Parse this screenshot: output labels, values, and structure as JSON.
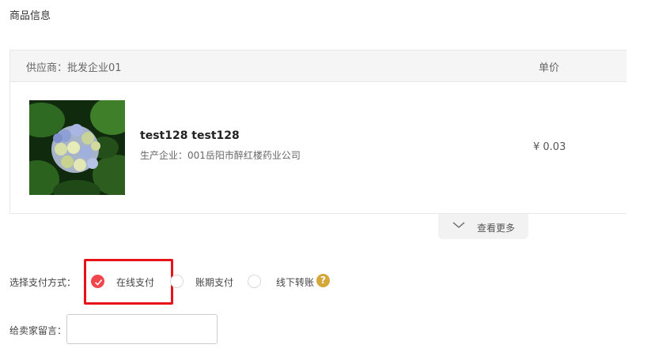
{
  "section_title": "商品信息",
  "order": {
    "supplier_label": "供应商：批发企业01",
    "price_header": "单价",
    "product": {
      "name": "test128 test128",
      "manufacturer": "生产企业：001岳阳市醉红楼药业公司",
      "price": "¥ 0.03",
      "image": "hydrangea-flower-photo"
    },
    "more_label": "查看更多"
  },
  "payment": {
    "label": "选择支付方式：",
    "options": [
      {
        "label": "在线支付",
        "checked": true
      },
      {
        "label": "账期支付",
        "checked": false
      },
      {
        "label": "线下转账",
        "checked": false
      }
    ],
    "help_symbol": "?"
  },
  "message": {
    "label": "给卖家留言：",
    "value": "",
    "placeholder": ""
  },
  "colors": {
    "accent_red": "#f0464c",
    "highlight_border": "#e8121a",
    "help_icon": "#d4a73a"
  }
}
